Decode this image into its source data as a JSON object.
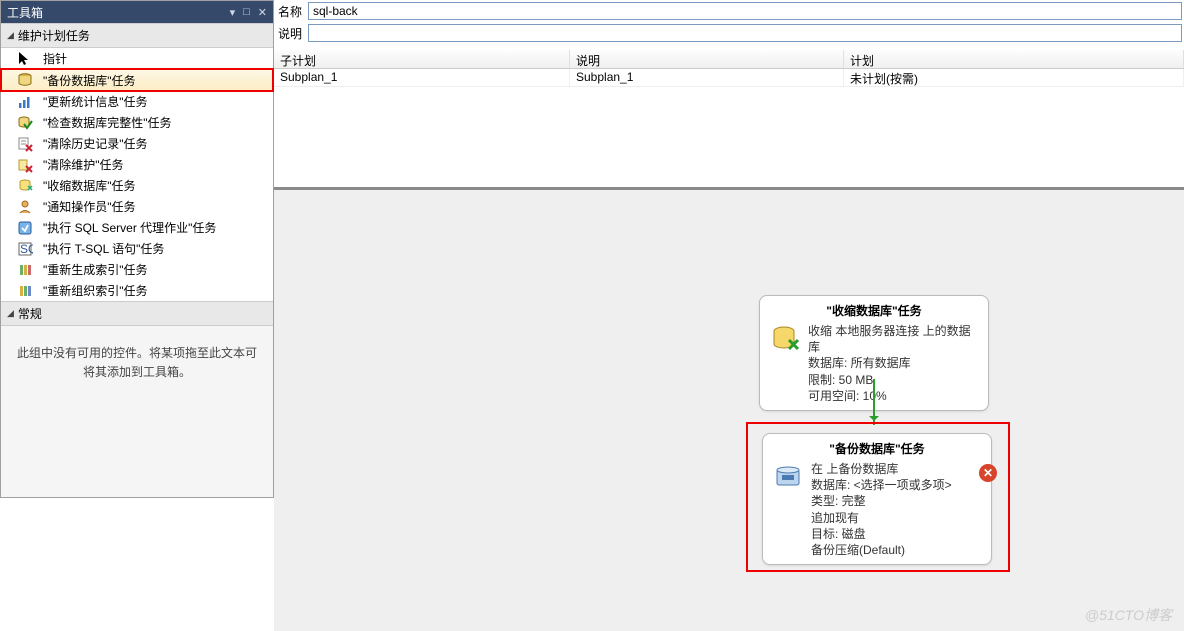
{
  "toolbox": {
    "title": "工具箱",
    "section_maintenance": "维护计划任务",
    "section_general": "常规",
    "items": [
      {
        "icon": "pointer",
        "label": "指针"
      },
      {
        "icon": "backup-db",
        "label": "\"备份数据库\"任务"
      },
      {
        "icon": "update-stats",
        "label": "\"更新统计信息\"任务"
      },
      {
        "icon": "check-integrity",
        "label": "\"检查数据库完整性\"任务"
      },
      {
        "icon": "clear-history",
        "label": "\"清除历史记录\"任务"
      },
      {
        "icon": "clear-maint",
        "label": "\"清除维护\"任务"
      },
      {
        "icon": "shrink-db",
        "label": "\"收缩数据库\"任务"
      },
      {
        "icon": "notify-op",
        "label": "\"通知操作员\"任务"
      },
      {
        "icon": "exec-agent",
        "label": "\"执行 SQL Server 代理作业\"任务"
      },
      {
        "icon": "exec-tsql",
        "label": "\"执行 T-SQL 语句\"任务"
      },
      {
        "icon": "rebuild-idx",
        "label": "\"重新生成索引\"任务"
      },
      {
        "icon": "reorg-idx",
        "label": "\"重新组织索引\"任务"
      }
    ],
    "empty_text": "此组中没有可用的控件。将某项拖至此文本可将其添加到工具箱。"
  },
  "meta": {
    "name_label": "名称",
    "name_value": "sql-back",
    "desc_label": "说明",
    "desc_value": ""
  },
  "grid": {
    "headers": [
      "子计划",
      "说明",
      "计划"
    ],
    "row": [
      "Subplan_1",
      "Subplan_1",
      "未计划(按需)"
    ]
  },
  "shrink_task": {
    "title": "\"收缩数据库\"任务",
    "line1": "收缩 本地服务器连接 上的数据库",
    "line2": "数据库: 所有数据库",
    "line3": "限制: 50 MB",
    "line4": "可用空间: 10%"
  },
  "backup_task": {
    "title": "\"备份数据库\"任务",
    "line1": "在  上备份数据库",
    "line2": "数据库: <选择一项或多项>",
    "line3": "类型: 完整",
    "line4": "追加现有",
    "line5": "目标: 磁盘",
    "line6": "备份压缩(Default)"
  },
  "watermark": "@51CTO博客"
}
